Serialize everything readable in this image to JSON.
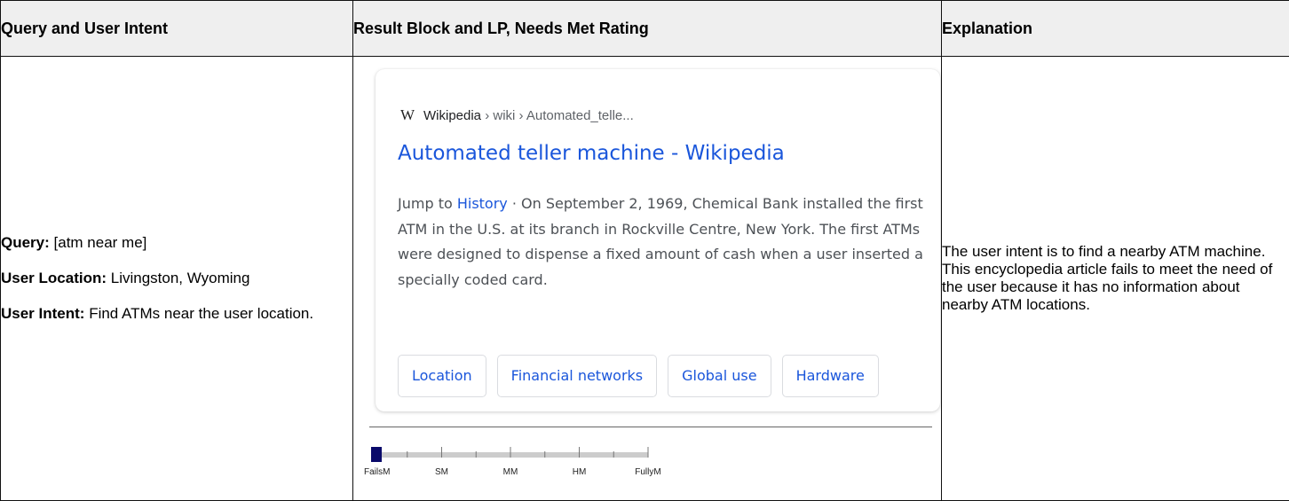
{
  "headers": {
    "col1": "Query and User Intent",
    "col2": "Result Block and LP, Needs Met Rating",
    "col3": "Explanation"
  },
  "query": {
    "query_label": "Query:",
    "query_value": " [atm near me]",
    "location_label": "User Location:",
    "location_value": " Livingston, Wyoming",
    "intent_label": "User Intent:",
    "intent_value": " Find ATMs near the user location."
  },
  "result": {
    "logo_glyph": "W",
    "breadcrumb_site": "Wikipedia",
    "breadcrumb_path": " › wiki › Automated_telle...",
    "title": "Automated teller machine - Wikipedia",
    "snippet_prefix": "Jump to ",
    "snippet_link": "History",
    "snippet_text": " · On September 2, 1969, Chemical Bank installed the first ATM in the U.S. at its branch in Rockville Centre, New York. The first ATMs were designed to dispense a fixed amount of cash when a user inserted a specially coded card.",
    "chips": [
      "Location",
      "Financial networks",
      "Global use",
      "Hardware"
    ]
  },
  "rating": {
    "labels": [
      "FailsM",
      "SM",
      "MM",
      "HM",
      "FullyM"
    ],
    "value_fraction": 0.0,
    "marker_color": "#0a0a6a",
    "track_color": "#cccccc"
  },
  "explanation": {
    "text": "The user intent is to find a nearby ATM machine.  This encyclopedia article fails to meet the need of the user because it has no information about nearby ATM locations."
  }
}
